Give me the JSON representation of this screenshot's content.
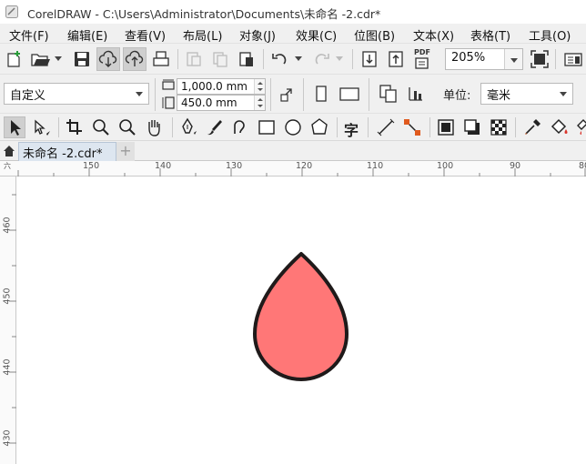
{
  "window": {
    "title": "CorelDRAW - C:\\Users\\Administrator\\Documents\\未命名 -2.cdr*"
  },
  "menu": [
    {
      "label": "文件(F)"
    },
    {
      "label": "编辑(E)"
    },
    {
      "label": "查看(V)"
    },
    {
      "label": "布局(L)"
    },
    {
      "label": "对象(J)"
    },
    {
      "label": "效果(C)"
    },
    {
      "label": "位图(B)"
    },
    {
      "label": "文本(X)"
    },
    {
      "label": "表格(T)"
    },
    {
      "label": "工具(O)"
    }
  ],
  "toolbar": {
    "zoom_value": "205%",
    "pdf_label": "PDF"
  },
  "property_bar": {
    "page_size_value": "自定义",
    "width_value": "1,000.0 mm",
    "height_value": "450.0 mm",
    "units_label": "单位:",
    "units_value": "毫米"
  },
  "toolbox": {
    "text_tool_glyph": "字"
  },
  "document_tab": {
    "label": "未命名 -2.cdr*",
    "add_label": "+"
  },
  "rulers": {
    "horizontal_ticks": [
      "150",
      "140",
      "130",
      "120",
      "110",
      "100",
      "90",
      "80"
    ],
    "vertical_ticks": [
      "460",
      "450",
      "440",
      "430"
    ],
    "corner_label": "六"
  },
  "drawing": {
    "shape": "droplet",
    "fill_color": "#ff7777",
    "stroke_color": "#1f1a1a"
  },
  "colors": {
    "toolbar_bg": "#f0f0f0",
    "canvas_bg": "#ffffff",
    "tab_active_bg": "#dde6f0"
  }
}
